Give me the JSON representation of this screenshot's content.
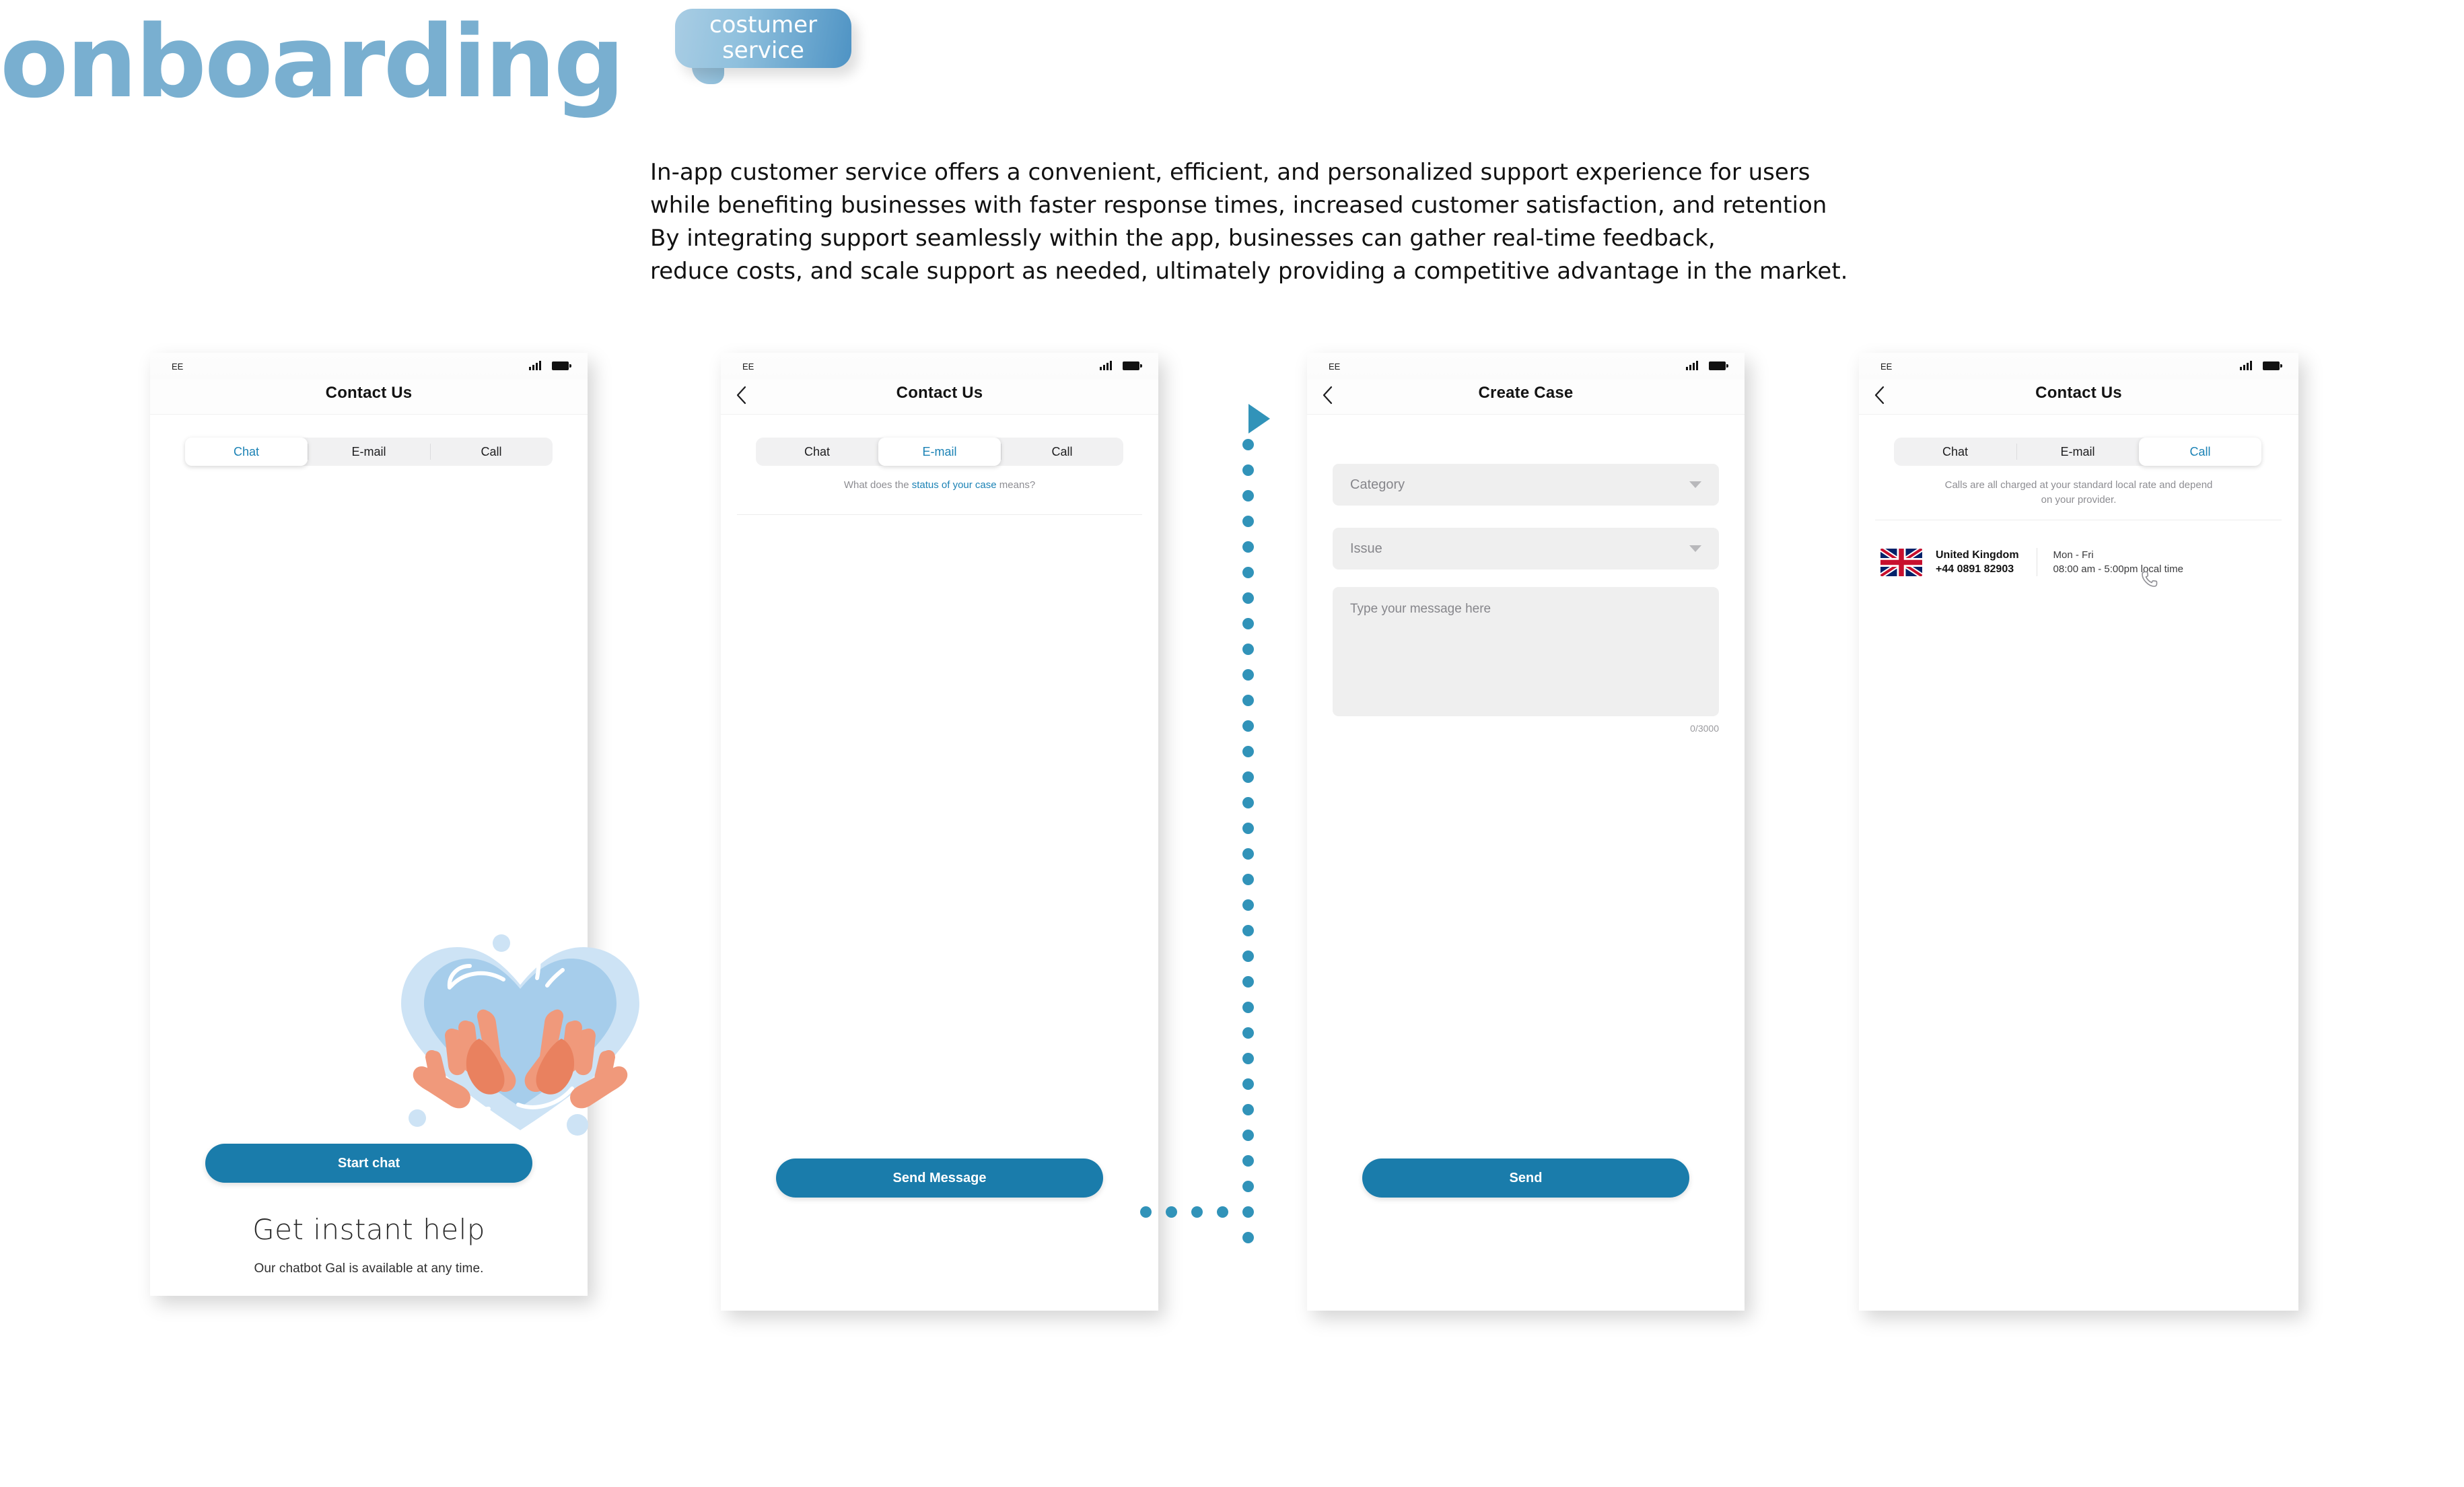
{
  "header": {
    "title": "onboarding",
    "bubble_line1": "costumer",
    "bubble_line2": "service",
    "description": "In-app customer service offers a convenient, efficient, and personalized support experience for users while benefiting businesses with faster response times, increased customer satisfaction, and retention By integrating support seamlessly within the app, businesses can gather real-time feedback, reduce costs, and scale support as needed, ultimately providing a competitive advantage in the market.",
    "description_lines": [
      "In-app customer service offers a convenient, efficient, and personalized support experience for users",
      "while benefiting businesses with faster response times, increased customer satisfaction, and retention",
      "By integrating support seamlessly within the app, businesses can gather real-time feedback,",
      "reduce costs, and scale support as needed, ultimately providing a competitive advantage in the market."
    ]
  },
  "colors": {
    "brand_blue": "#1a7cab",
    "accent_blue": "#1b82b5",
    "connector_blue": "#3193b9",
    "title_blue": "#79afd0",
    "field_grey": "#efefef",
    "muted_text": "#8d8d92"
  },
  "status_bar": {
    "carrier": "EE",
    "signal_icon": "signal-bars-icon",
    "battery_icon": "battery-icon"
  },
  "screens": [
    {
      "id": "chat",
      "nav_title": "Contact Us",
      "has_back": false,
      "back_icon": "chevron-left-icon",
      "tabs": [
        {
          "label": "Chat",
          "active": true
        },
        {
          "label": "E-mail",
          "active": false
        },
        {
          "label": "Call",
          "active": false
        }
      ],
      "illustration": "hands-heart-illustration",
      "headline": "Get instant help",
      "subline": "Our chatbot Gal is available at any time.",
      "cta": "Start chat"
    },
    {
      "id": "email",
      "nav_title": "Contact Us",
      "has_back": true,
      "back_icon": "chevron-left-icon",
      "tabs": [
        {
          "label": "Chat",
          "active": false
        },
        {
          "label": "E-mail",
          "active": true
        },
        {
          "label": "Call",
          "active": false
        }
      ],
      "hint_prefix": "What does the ",
      "hint_link": "status of your case",
      "hint_suffix": " means?",
      "cta": "Send Message"
    },
    {
      "id": "create-case",
      "nav_title": "Create Case",
      "has_back": true,
      "back_icon": "chevron-left-icon",
      "fields": [
        {
          "label": "Category",
          "icon": "chevron-down-icon"
        },
        {
          "label": "Issue",
          "icon": "chevron-down-icon"
        }
      ],
      "message_placeholder": "Type your message here",
      "counter": "0/3000",
      "cta": "Send"
    },
    {
      "id": "call",
      "nav_title": "Contact Us",
      "has_back": true,
      "back_icon": "chevron-left-icon",
      "tabs": [
        {
          "label": "Chat",
          "active": false
        },
        {
          "label": "E-mail",
          "active": false
        },
        {
          "label": "Call",
          "active": true
        }
      ],
      "disclaimer_line1": "Calls are all charged at your standard local rate and depend",
      "disclaimer_line2": "on your provider.",
      "contacts": [
        {
          "flag": "uk-flag-icon",
          "country": "United Kingdom",
          "number": "+44 0891 82903",
          "days": "Mon - Fri",
          "hours": "08:00 am - 5:00pm local time",
          "action_icon": "phone-handset-icon"
        }
      ]
    }
  ],
  "connector": {
    "icon": "arrow-right-icon",
    "style": "dotted-flow-line"
  }
}
